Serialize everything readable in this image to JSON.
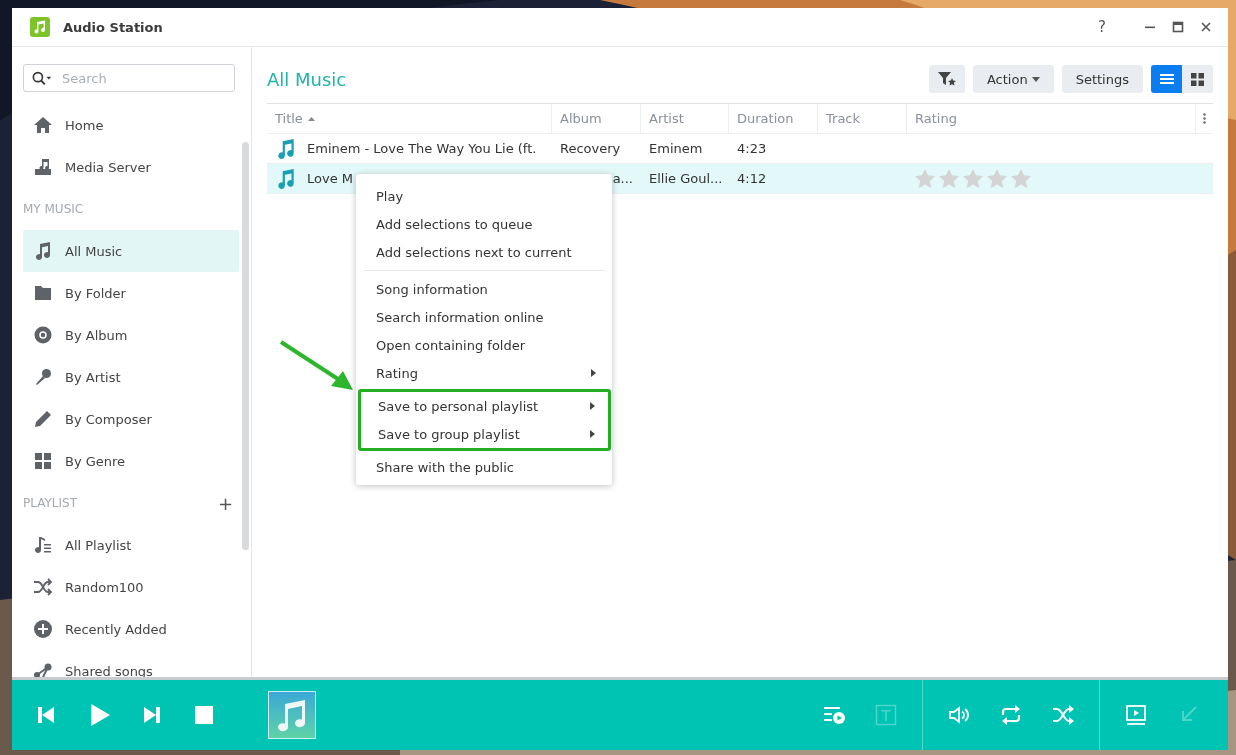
{
  "window": {
    "title": "Audio Station",
    "help_label": "?"
  },
  "sidebar": {
    "search": {
      "placeholder": "Search"
    },
    "top_items": [
      {
        "label": "Home",
        "selected": false
      },
      {
        "label": "Media Server",
        "selected": false
      }
    ],
    "sections": [
      {
        "heading": "MY MUSIC",
        "items": [
          {
            "label": "All Music",
            "selected": true
          },
          {
            "label": "By Folder",
            "selected": false
          },
          {
            "label": "By Album",
            "selected": false
          },
          {
            "label": "By Artist",
            "selected": false
          },
          {
            "label": "By Composer",
            "selected": false
          },
          {
            "label": "By Genre",
            "selected": false
          }
        ]
      },
      {
        "heading": "PLAYLIST",
        "add_label": "+",
        "items": [
          {
            "label": "All Playlist",
            "selected": false
          },
          {
            "label": "Random100",
            "selected": false
          },
          {
            "label": "Recently Added",
            "selected": false
          },
          {
            "label": "Shared songs",
            "selected": false
          }
        ]
      }
    ]
  },
  "main": {
    "title": "All Music",
    "action_label": "Action",
    "settings_label": "Settings",
    "views": [
      {
        "selected": true
      },
      {
        "selected": false
      }
    ],
    "table": {
      "columns": [
        "Title",
        "Album",
        "Artist",
        "Duration",
        "Track",
        "Rating"
      ],
      "rows": [
        {
          "title": "Eminem - Love The Way You Lie (ft.",
          "album": "Recovery",
          "artist": "Eminem",
          "duration": "4:23",
          "selected": false
        },
        {
          "title": "Love M",
          "album": "a...",
          "artist": "Ellie Goul...",
          "duration": "4:12",
          "selected": true,
          "stars": 0
        }
      ]
    }
  },
  "context_menu": {
    "groups": [
      {
        "items": [
          {
            "label": "Play",
            "submenu": false,
            "annotated": false
          },
          {
            "label": "Add selections to queue",
            "submenu": false,
            "annotated": false
          },
          {
            "label": "Add selections next to current",
            "submenu": false,
            "annotated": false
          }
        ]
      },
      {
        "items": [
          {
            "label": "Song information",
            "submenu": false,
            "annotated": false
          },
          {
            "label": "Search information online",
            "submenu": false,
            "annotated": false
          },
          {
            "label": "Open containing folder",
            "submenu": false,
            "annotated": false
          },
          {
            "label": "Rating",
            "submenu": true,
            "annotated": false
          },
          {
            "label": "Save to personal playlist",
            "submenu": true,
            "annotated": true
          },
          {
            "label": "Save to group playlist",
            "submenu": true,
            "annotated": true
          },
          {
            "label": "Share with the public",
            "submenu": false,
            "annotated": false
          }
        ]
      }
    ]
  },
  "player": {
    "right_buttons": [
      {
        "disabled": false
      },
      {
        "disabled": true
      },
      {
        "disabled": false
      },
      {
        "disabled": false
      },
      {
        "disabled": false
      },
      {
        "disabled": false
      },
      {
        "disabled": true
      }
    ]
  }
}
